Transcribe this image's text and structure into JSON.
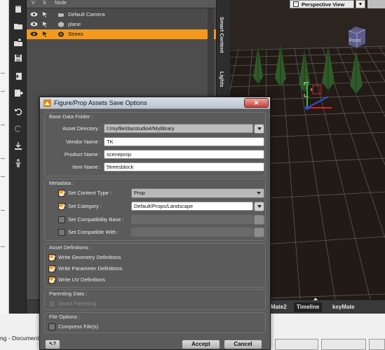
{
  "scene": {
    "header": {
      "col_visible": "V",
      "col_select": "S",
      "col_node": "Node"
    },
    "nodes": [
      {
        "name": "Default Camera",
        "icon": "camera-icon",
        "selected": false
      },
      {
        "name": "plane",
        "icon": "prop-icon",
        "selected": false
      },
      {
        "name": "Strees",
        "icon": "group-icon",
        "selected": true
      }
    ]
  },
  "side_tabs": {
    "smart_content": "Smart Content",
    "lights": "Lights"
  },
  "viewport": {
    "camera_label": "Perspective View",
    "nav_cube_label": "Front",
    "menu_glyph": "▼"
  },
  "bottom_tabs": {
    "tab1": "Mate2",
    "tab2": "Timeline",
    "tab3": "keyMate"
  },
  "taskbar": {
    "text": "ng - Document"
  },
  "dialog": {
    "title": "Figure/Prop Assets Save Options",
    "close_glyph": "✕",
    "base_folder": {
      "title": "Base Data Folder :",
      "asset_directory_label": "Asset Directory :",
      "asset_directory_value": "I:/myfile/dazstudio4/Mylibrary",
      "vendor_label": "Vendor Name :",
      "vendor_value": "TK",
      "product_label": "Product Name :",
      "product_value": "sceneprop",
      "item_label": "Item Name :",
      "item_value": "5treesblock"
    },
    "metadata": {
      "title": "Metadata :",
      "content_type_label": "Set Content Type :",
      "content_type_value": "Prop",
      "category_label": "Set Category :",
      "category_value": "Default/Props/Landscape",
      "compat_base_label": "Set Compatibility Base :",
      "compatible_with_label": "Set Compatible With :"
    },
    "asset_defs": {
      "title": "Asset Definitions :",
      "geometry": "Write Geometry Definitions",
      "parameter": "Write Parameter Definitions",
      "uv": "Write UV Definitions"
    },
    "parenting": {
      "title": "Parenting Data :",
      "smart_parenting": "Smart Parenting"
    },
    "file_options": {
      "title": "File Options :",
      "compress": "Compress File(s)"
    },
    "buttons": {
      "help": "?",
      "accept": "Accept",
      "cancel": "Cancel"
    }
  },
  "colors": {
    "selection": "#f39a1e",
    "checkbox_checked": "#f0a23b",
    "dialog_bg": "#5b5b5b"
  }
}
